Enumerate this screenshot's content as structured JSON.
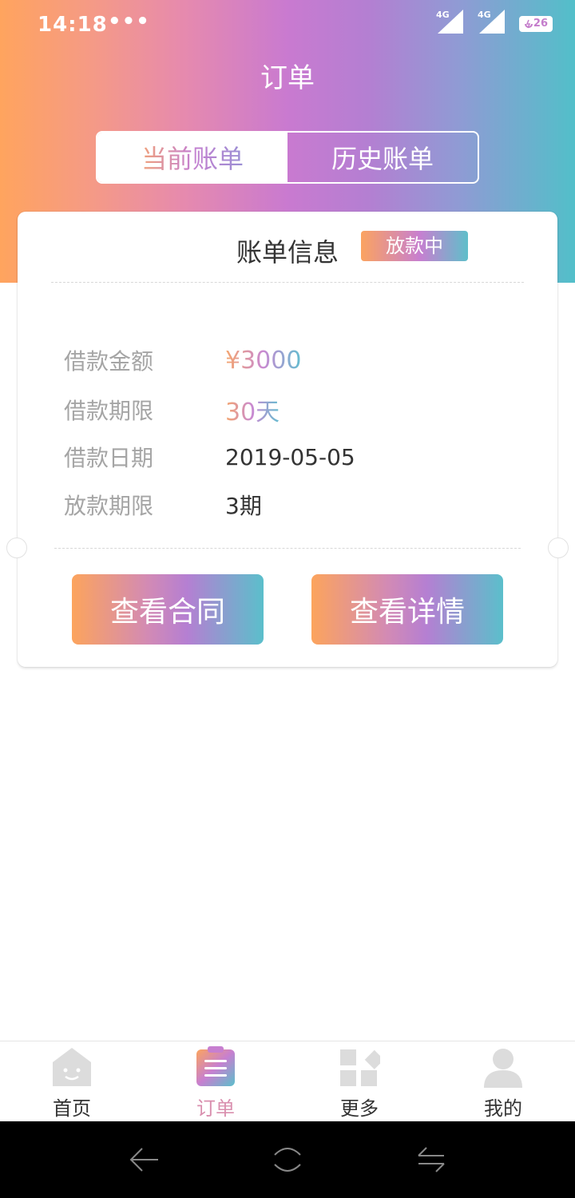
{
  "status_bar": {
    "time": "14:18",
    "dots": "•••",
    "signal_1": "4G",
    "signal_2": "4G",
    "battery": "26"
  },
  "header": {
    "title": "订单"
  },
  "tabs": [
    {
      "label": "当前账单",
      "active": true
    },
    {
      "label": "历史账单",
      "active": false
    }
  ],
  "card": {
    "title": "账单信息",
    "status": "放款中",
    "rows": [
      {
        "label": "借款金额",
        "value": "¥3000"
      },
      {
        "label": "借款期限",
        "value": "30天"
      },
      {
        "label": "借款日期",
        "value": "2019-05-05"
      },
      {
        "label": "放款期限",
        "value": "3期"
      }
    ],
    "buttons": {
      "contract": "查看合同",
      "detail": "查看详情"
    }
  },
  "bottom_nav": [
    {
      "label": "首页",
      "icon": "home-face-icon",
      "active": false
    },
    {
      "label": "订单",
      "icon": "order-list-icon",
      "active": true
    },
    {
      "label": "更多",
      "icon": "grid-more-icon",
      "active": false
    },
    {
      "label": "我的",
      "icon": "user-icon",
      "active": false
    }
  ],
  "colors": {
    "gradient_start": "#ffa45e",
    "gradient_mid": "#c97ad0",
    "gradient_end": "#52bfc9",
    "label_gray": "#a5a5a5"
  }
}
